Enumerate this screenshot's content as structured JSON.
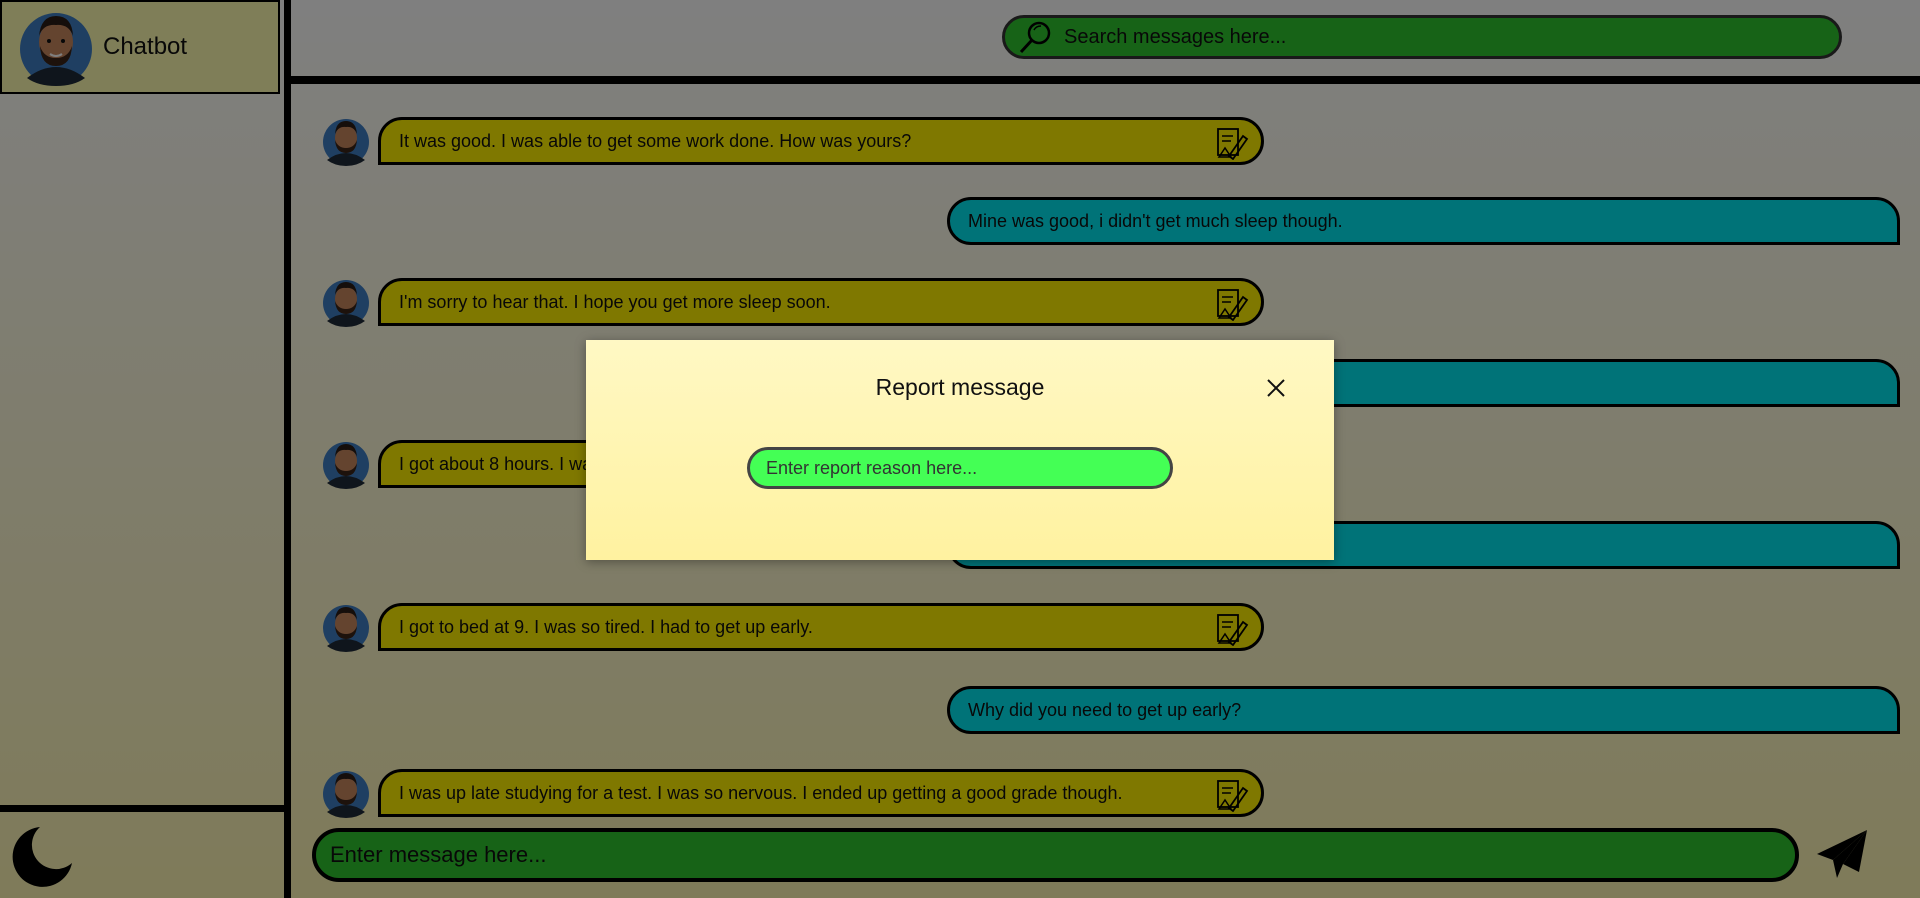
{
  "app": {
    "name": "Chatbot"
  },
  "search": {
    "placeholder": "Search messages here..."
  },
  "messages": [
    {
      "sender": "bot",
      "text": "It was good. I was able to get some work done. How was yours?"
    },
    {
      "sender": "user",
      "text": "Mine was good, i didn't get much sleep though."
    },
    {
      "sender": "bot",
      "text": "I'm sorry to hear that. I hope you get more sleep soon."
    },
    {
      "sender": "user",
      "text": ""
    },
    {
      "sender": "bot",
      "text": "I got about 8 hours. I wa"
    },
    {
      "sender": "user",
      "text": ""
    },
    {
      "sender": "bot",
      "text": "I got to bed at 9. I was so tired. I had to get up early."
    },
    {
      "sender": "user",
      "text": "Why did you need to get up early?"
    },
    {
      "sender": "bot",
      "text": "I was up late studying for a test. I was so nervous. I ended up getting a good grade though."
    }
  ],
  "composer": {
    "placeholder": "Enter message here..."
  },
  "modal": {
    "title": "Report message",
    "reason_placeholder": "Enter report reason here..."
  },
  "icons": {
    "theme_toggle": "moon-icon",
    "send": "paper-plane-icon",
    "search": "magnifier-icon",
    "report": "report-flag-icon",
    "close": "close-icon"
  },
  "colors": {
    "bot_bubble": "#fff000",
    "user_bubble": "#00e6f0",
    "input_green": "#2ec72e",
    "report_input_green": "#44ff55",
    "sidebar_header": "#fffdb0"
  }
}
